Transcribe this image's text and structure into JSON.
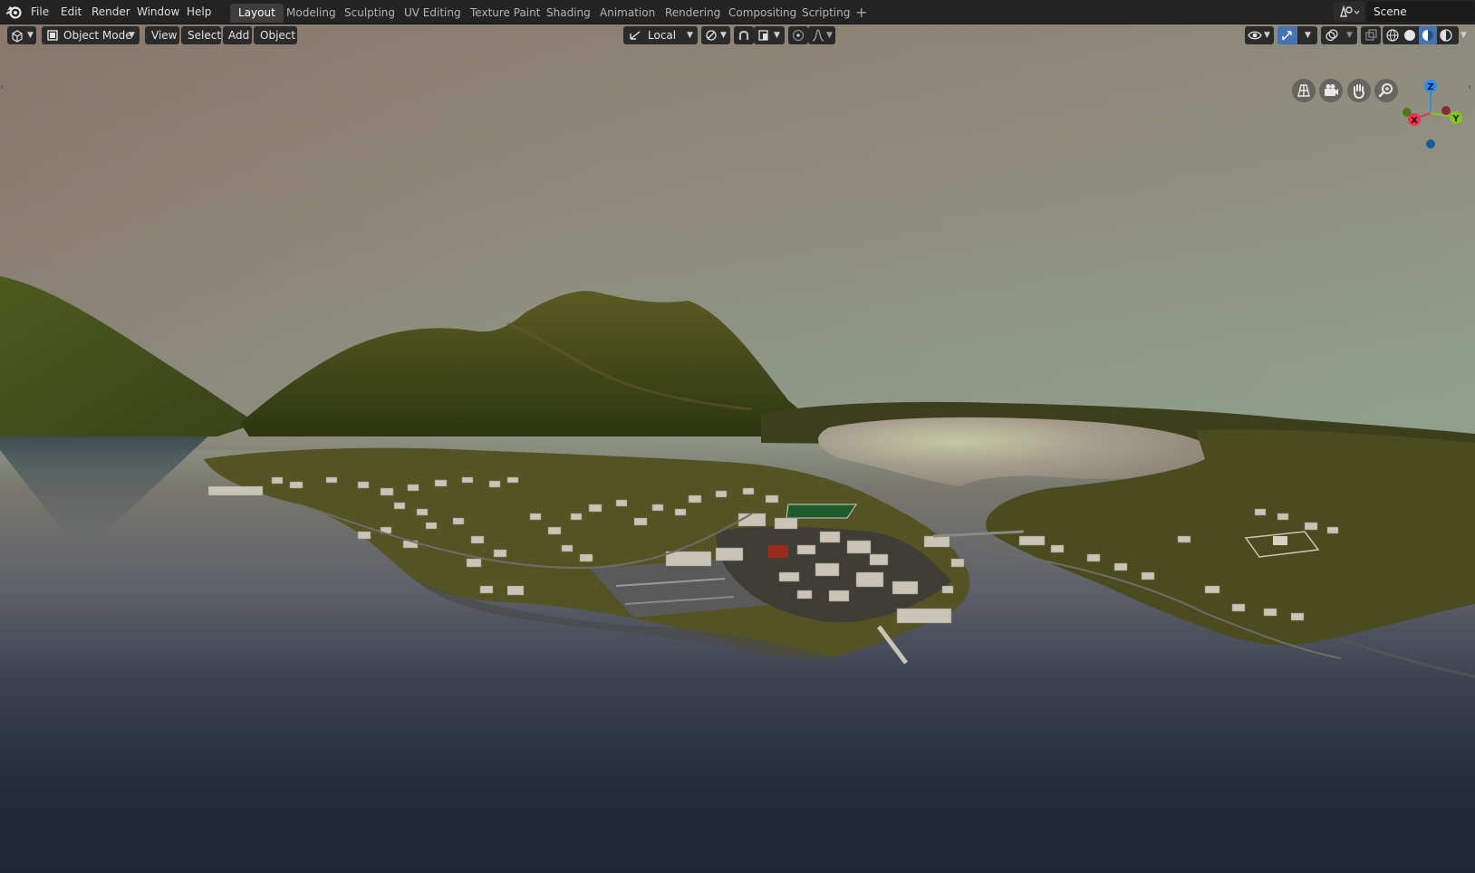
{
  "app": {
    "name": "Blender"
  },
  "menu": {
    "items": [
      "File",
      "Edit",
      "Render",
      "Window",
      "Help"
    ]
  },
  "workspaces": {
    "tabs": [
      "Layout",
      "Modeling",
      "Sculpting",
      "UV Editing",
      "Texture Paint",
      "Shading",
      "Animation",
      "Rendering",
      "Compositing",
      "Scripting"
    ],
    "active": "Layout",
    "add_label": "+"
  },
  "scene": {
    "name": "Scene"
  },
  "viewport_header": {
    "mode": "Object Mode",
    "menus": [
      "View",
      "Select",
      "Add",
      "Object"
    ],
    "transform_orientation": "Local"
  },
  "gizmo": {
    "x_label": "X",
    "y_label": "Y",
    "z_label": "Z"
  },
  "icons": {
    "logo": "blender-logo-icon",
    "editor_type": "view3d-editor-icon",
    "mode": "object-mode-icon",
    "orientation": "local-orientation-icon",
    "pivot": "pivot-point-icon",
    "snap": "snap-magnet-icon",
    "snap_target": "snap-increment-icon",
    "proportional": "proportional-edit-icon",
    "falloff": "falloff-curve-icon",
    "visibility": "visibility-eye-icon",
    "gizmos": "gizmo-toggle-icon",
    "overlays": "overlays-icon",
    "xray": "xray-toggle-icon",
    "shading_wire": "wireframe-shading-icon",
    "shading_solid": "solid-shading-icon",
    "shading_material": "material-preview-icon",
    "shading_rendered": "rendered-shading-icon",
    "grid_view": "toggle-perspective-grid-icon",
    "camera_view": "camera-view-icon",
    "pan": "pan-hand-icon",
    "zoom": "zoom-magnifier-icon"
  },
  "colors": {
    "axis_x": "#e8354f",
    "axis_y": "#84c41c",
    "axis_z": "#2d8ceb",
    "active_tab": "#3d3d3d",
    "active_toggle": "#4772b3"
  }
}
